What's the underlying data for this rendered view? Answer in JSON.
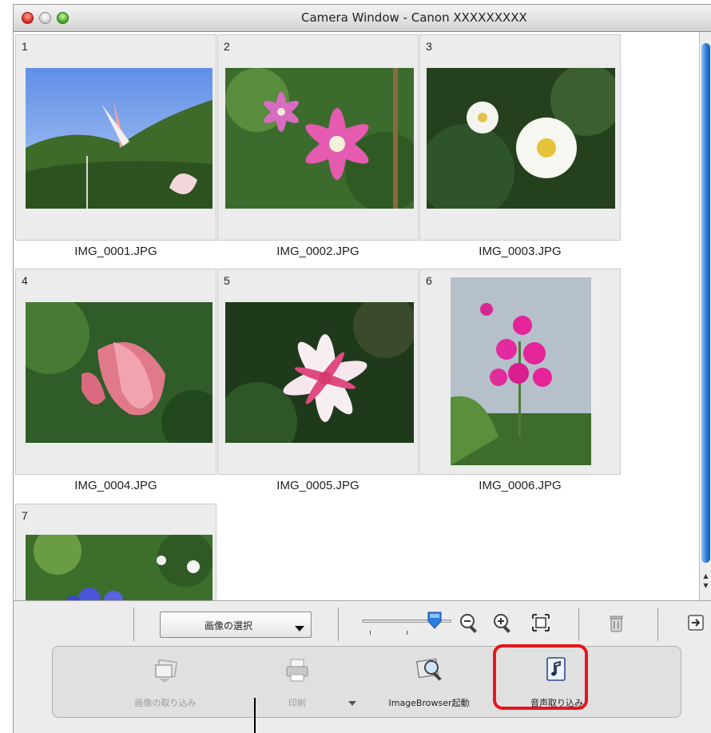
{
  "window": {
    "title": "Camera Window - Canon XXXXXXXXX"
  },
  "thumbnails": [
    {
      "number": "1",
      "filename": "IMG_0001.JPG"
    },
    {
      "number": "2",
      "filename": "IMG_0002.JPG"
    },
    {
      "number": "3",
      "filename": "IMG_0003.JPG"
    },
    {
      "number": "4",
      "filename": "IMG_0004.JPG"
    },
    {
      "number": "5",
      "filename": "IMG_0005.JPG"
    },
    {
      "number": "6",
      "filename": "IMG_0006.JPG"
    },
    {
      "number": "7",
      "filename": ""
    }
  ],
  "toolbar": {
    "select_label": "画像の選択",
    "zoom_level": 0.85,
    "icons": [
      "zoom-out-icon",
      "zoom-in-icon",
      "fit-view-icon",
      "trash-icon",
      "export-icon"
    ]
  },
  "actions": {
    "import_images": "画像の取り込み",
    "print": "印刷",
    "imagebrowser": "ImageBrowser起動",
    "import_sound": "音声取り込み"
  },
  "colors": {
    "highlight": "#e8151a",
    "scrollbar": "#2b77d8",
    "slider_knob": "#2b7fe0"
  }
}
